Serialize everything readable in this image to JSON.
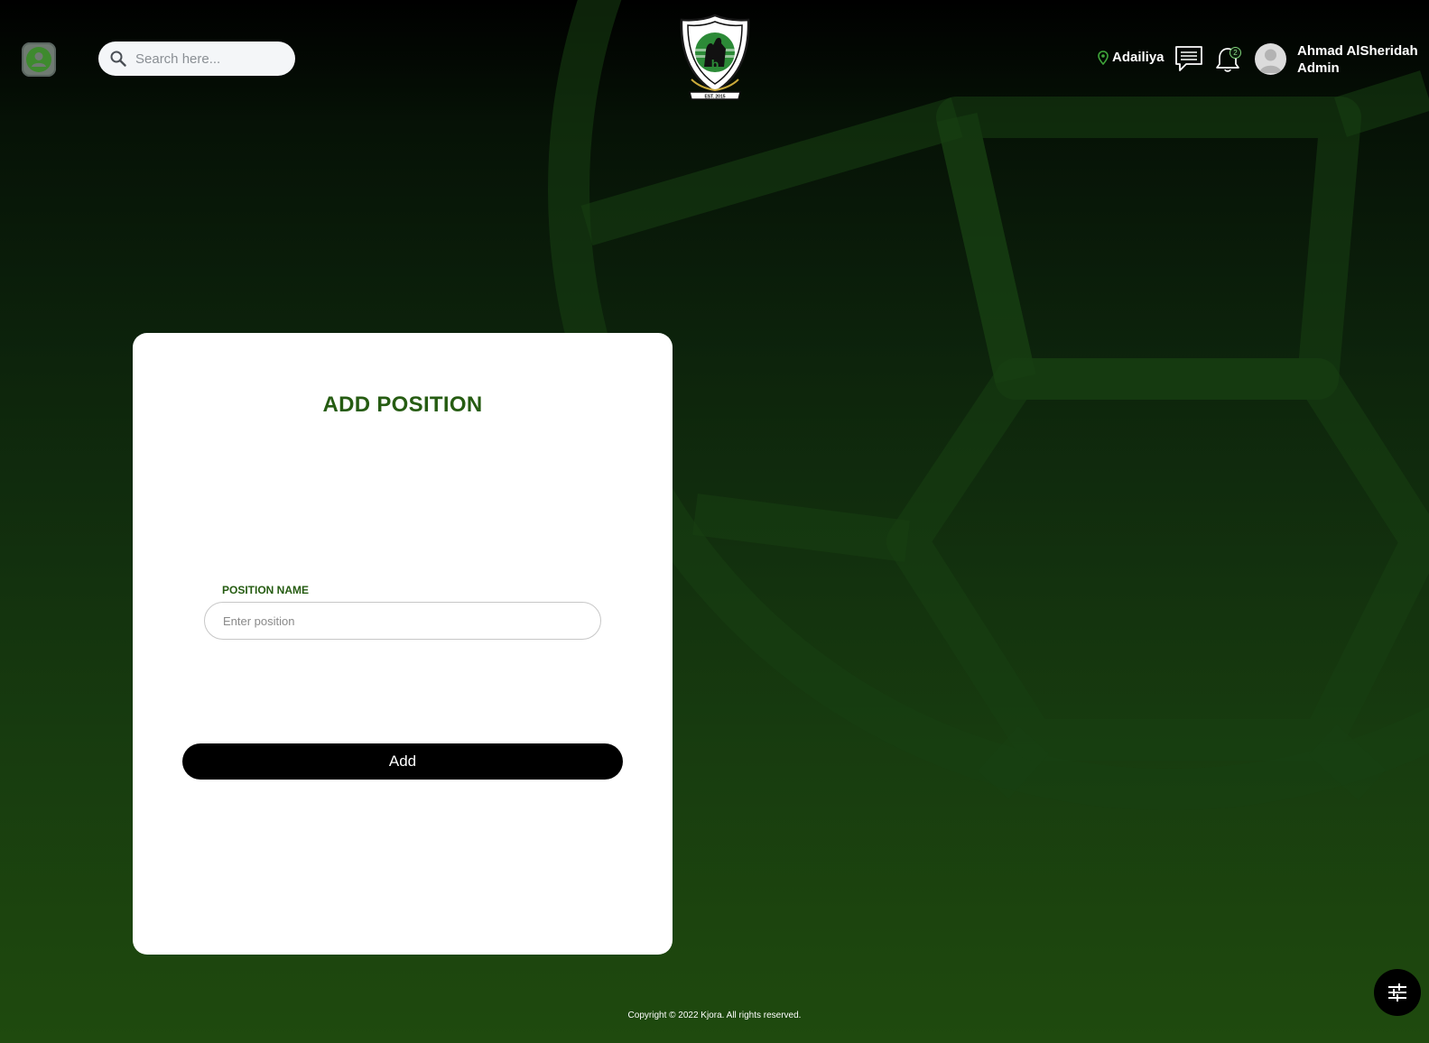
{
  "header": {
    "search_placeholder": "Search here...",
    "location": "Adailiya",
    "notification_count": "2",
    "user_name": "Ahmad AlSheridah",
    "user_role": "Admin",
    "logo_text": "EST. 2015"
  },
  "form": {
    "title": "ADD POSITION",
    "position_label": "POSITION NAME",
    "position_placeholder": "Enter position",
    "position_value": "",
    "submit_label": "Add"
  },
  "footer": {
    "copyright": "Copyright © 2022 Kjora. All rights reserved."
  },
  "colors": {
    "brand_green": "#265c12",
    "button_black": "#000000"
  },
  "icons": {
    "menu": "user-circle-icon",
    "search": "search-icon",
    "location": "map-pin-icon",
    "chat": "chat-icon",
    "bell": "bell-icon",
    "settings": "sliders-icon"
  }
}
